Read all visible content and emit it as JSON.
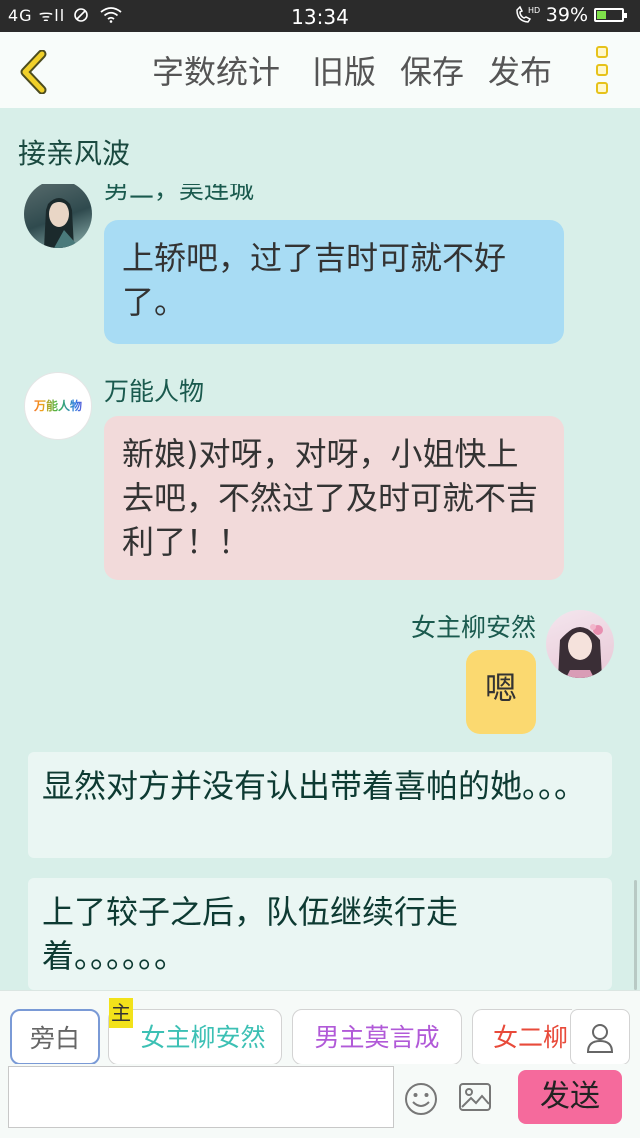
{
  "status_bar": {
    "signal": "4G ᯤll",
    "time": "13:34",
    "hd": "HD",
    "battery": "39%",
    "battery_level": 0.39
  },
  "header": {
    "buttons": [
      "字数统计",
      "旧版",
      "保存",
      "发布"
    ]
  },
  "doc_title": "接亲风波",
  "messages": [
    {
      "speaker": "男二，吴连城",
      "text": "上轿吧，过了吉时可就不好了。",
      "bubble_color": "#a8dcf4",
      "side": "left"
    },
    {
      "speaker": "万能人物",
      "avatar_text": "万能人物",
      "text": "新娘)对呀，对呀，小姐快上去吧，不然过了及时可就不吉利了！！",
      "bubble_color": "#f2dada",
      "side": "left"
    },
    {
      "speaker": "女主柳安然",
      "text": "嗯",
      "bubble_color": "#fbd970",
      "side": "right"
    }
  ],
  "narrations": [
    "显然对方并没有认出带着喜帕的她。。。",
    "上了较子之后，队伍继续行走着。。。。。。"
  ],
  "chips": [
    {
      "label": "旁白",
      "color": "#666666"
    },
    {
      "badge": "主",
      "label": "女主柳安然",
      "color": "#3cc0b4"
    },
    {
      "label": "男主莫言成",
      "color": "#b15ad8"
    },
    {
      "label": "女二柳",
      "color": "#e84a3a"
    }
  ],
  "input": {
    "placeholder": "",
    "send_label": "发送"
  },
  "colors": {
    "background": "#d8efe9",
    "accent_menu": "#e6c21a",
    "send_button": "#f56a9c"
  },
  "icons": [
    "back-chevron-icon",
    "more-menu-icon",
    "person-icon",
    "emoji-icon",
    "image-icon",
    "wifi-icon",
    "battery-icon"
  ]
}
